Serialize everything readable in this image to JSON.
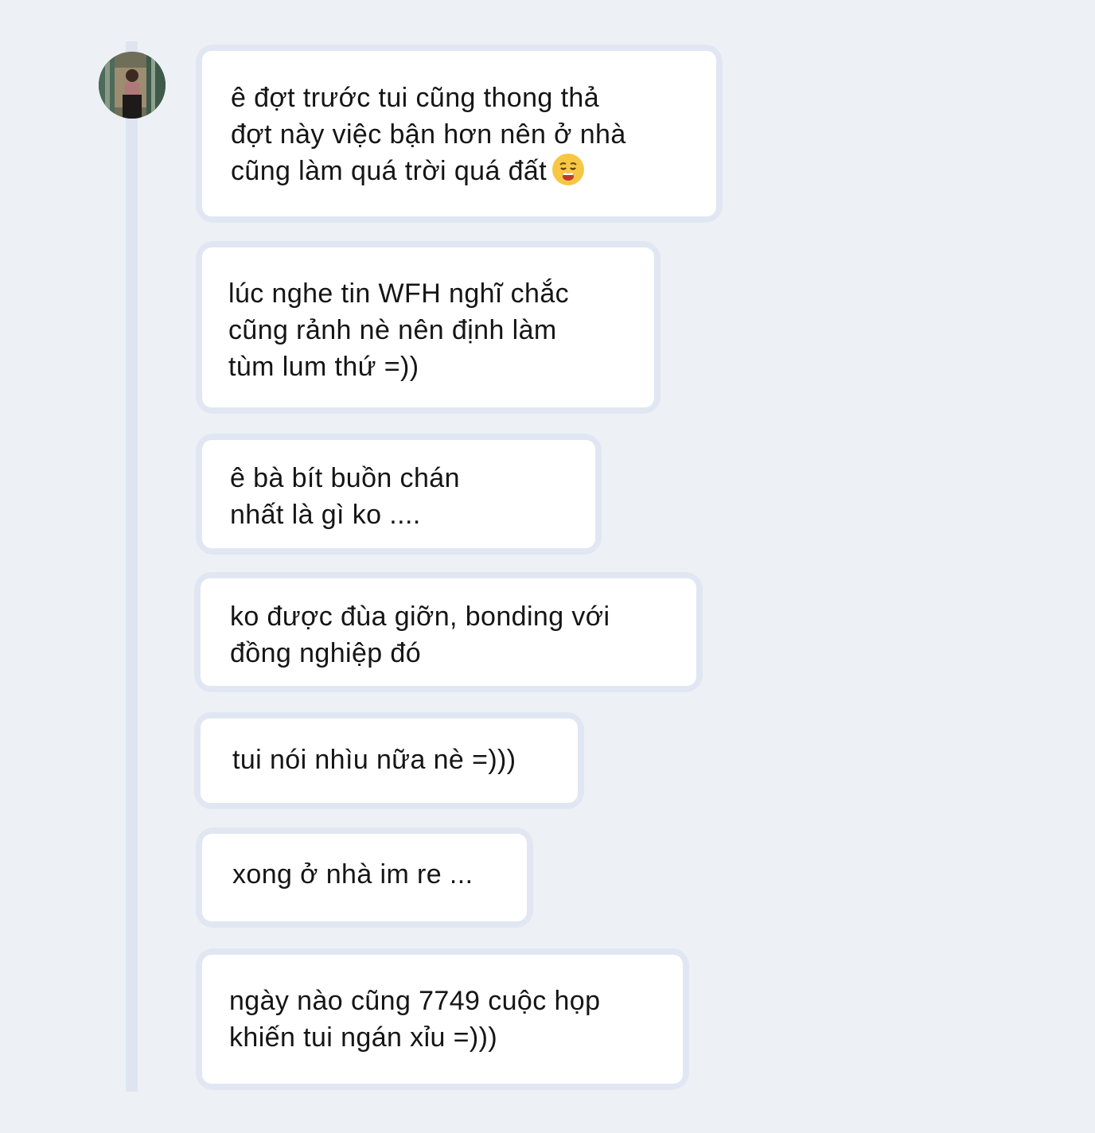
{
  "conversation": {
    "sender": {
      "avatar_icon": "user-photo-avatar"
    },
    "messages": [
      {
        "text": "ê đợt trước tui cũng thong thả\nđợt này việc bận hơn nên ở nhà\ncũng làm quá trời quá đất",
        "emoji": "disappointed-face-emoji"
      },
      {
        "text": "lúc nghe tin WFH nghĩ chắc\ncũng rảnh nè nên định làm\ntùm lum thứ =))"
      },
      {
        "text": "ê bà bít buồn chán\nnhất là gì ko ...."
      },
      {
        "text": "ko được đùa giỡn, bonding với\nđồng nghiệp đó"
      },
      {
        "text": "tui nói nhìu nữa nè =)))"
      },
      {
        "text": "xong ở nhà im re ..."
      },
      {
        "text": "ngày nào cũng 7749 cuộc họp\nkhiến tui ngán xỉu =)))"
      }
    ]
  },
  "colors": {
    "background": "#edf0f5",
    "bubble_border": "#e1e7f2",
    "bubble_fill": "#ffffff",
    "text": "#151515",
    "thread_line": "#dee5f0",
    "emoji_face": "#f7c744",
    "emoji_mouth": "#c0392b"
  }
}
